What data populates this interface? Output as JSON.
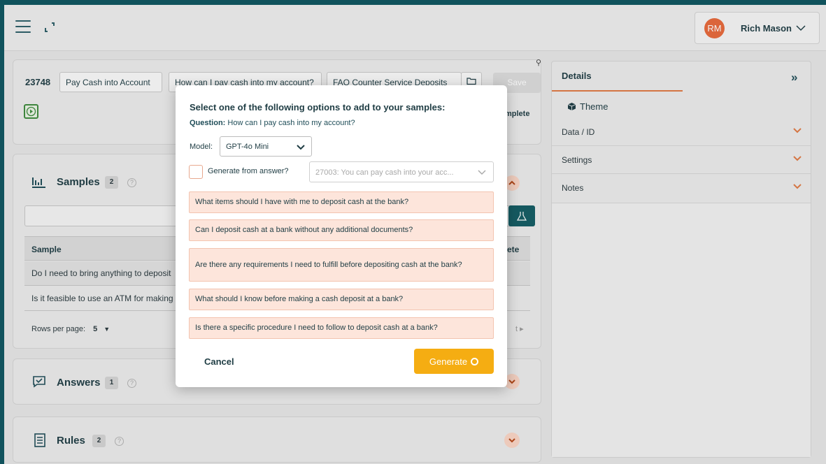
{
  "user": {
    "initials": "RM",
    "name": "Rich Mason"
  },
  "question": {
    "id": "23748",
    "title": "Pay Cash into Account",
    "text": "How can I pay cash into my account?",
    "category": "FAQ Counter Service Deposits",
    "save_label": "Save",
    "complete_label": "mplete"
  },
  "samples": {
    "title": "Samples",
    "count": "2",
    "column_sample": "Sample",
    "column_delete": "ete",
    "rows": [
      "Do I need to bring anything to deposit",
      "Is it feasible to use an ATM for making"
    ],
    "rows_per_page_label": "Rows per page:",
    "rows_per_page_value": "5",
    "next_label": "t ▸"
  },
  "answers": {
    "title": "Answers",
    "count": "1"
  },
  "rules": {
    "title": "Rules",
    "count": "2"
  },
  "right_panel": {
    "details_label": "Details",
    "theme_label": "Theme",
    "rows": [
      "Data / ID",
      "Settings",
      "Notes"
    ]
  },
  "modal": {
    "title": "Select one of the following options to add to your samples:",
    "question_label": "Question:",
    "question_text": "How can I pay cash into my account?",
    "model_label": "Model:",
    "model_value": "GPT-4o Mini",
    "generate_from_answer_label": "Generate from answer?",
    "answer_value": "27003: You can pay cash into your acc...",
    "options": [
      "What items should I have with me to deposit cash at the bank?",
      "Can I deposit cash at a bank without any additional documents?",
      "Are there any requirements I need to fulfill before depositing cash at the bank?",
      "What should I know before making a cash deposit at a bank?",
      "Is there a specific procedure I need to follow to deposit cash at a bank?"
    ],
    "cancel_label": "Cancel",
    "generate_label": "Generate"
  },
  "colors": {
    "accent_orange": "#e07a44",
    "generate_button": "#f5ad12",
    "option_bg": "#fde5db",
    "teal": "#135c63"
  }
}
